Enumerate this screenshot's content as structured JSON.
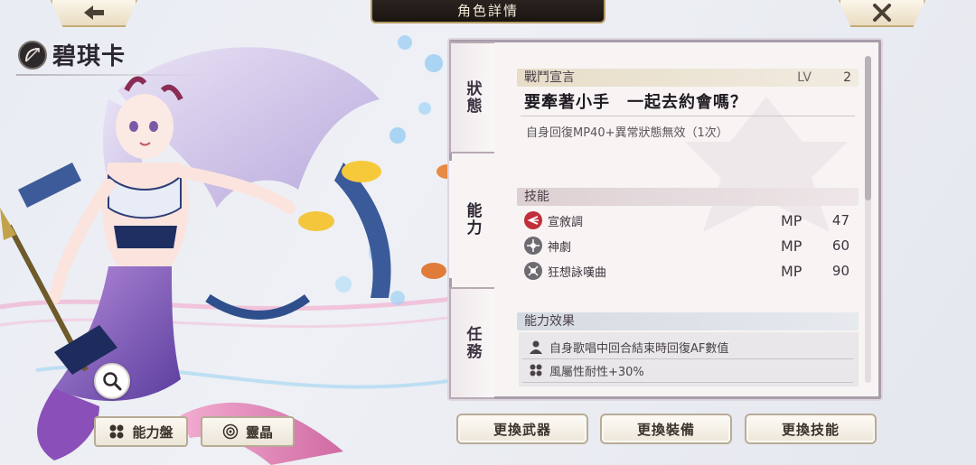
{
  "header": {
    "title": "角色詳情",
    "back_icon": "arrow-left-icon",
    "close_icon": "close-icon"
  },
  "character": {
    "name": "碧琪卡",
    "class_icon": "bow-class-icon"
  },
  "left_buttons": {
    "magnify_icon": "magnify-icon",
    "ability_board": "能力盤",
    "spirit_crystal": "靈晶"
  },
  "tabs": [
    {
      "label": "狀態",
      "active": false
    },
    {
      "label": "能力",
      "active": true
    },
    {
      "label": "任務",
      "active": false
    }
  ],
  "battle_declaration": {
    "header": "戰鬥宣言",
    "lv_label": "LV",
    "lv_value": "2",
    "title": "要牽著小手　一起去約會嗎？",
    "description": "自身回復MP40+異常狀態無效（1次）"
  },
  "skills": {
    "header": "技能",
    "items": [
      {
        "name": "宣敘調",
        "mp_label": "MP",
        "mp": "47",
        "icon": "recitative-skill-icon",
        "color": "#c0303a"
      },
      {
        "name": "神劇",
        "mp_label": "MP",
        "mp": "60",
        "icon": "oratorio-skill-icon",
        "color": "#6f6a72"
      },
      {
        "name": "狂想詠嘆曲",
        "mp_label": "MP",
        "mp": "90",
        "icon": "rhapsody-skill-icon",
        "color": "#6f6a72"
      }
    ]
  },
  "ability_effects": {
    "header": "能力效果",
    "items": [
      {
        "text": "自身歌唱中回合結束時回復AF數值",
        "icon": "person-icon"
      },
      {
        "text": "風屬性耐性+30%",
        "icon": "clover-icon"
      }
    ]
  },
  "actions": {
    "change_weapon": "更換武器",
    "change_equipment": "更換裝備",
    "change_skill": "更換技能"
  },
  "colors": {
    "panel_border": "#a99daa",
    "header_bg": "#1b1512",
    "gold_trim": "#b59a62"
  }
}
